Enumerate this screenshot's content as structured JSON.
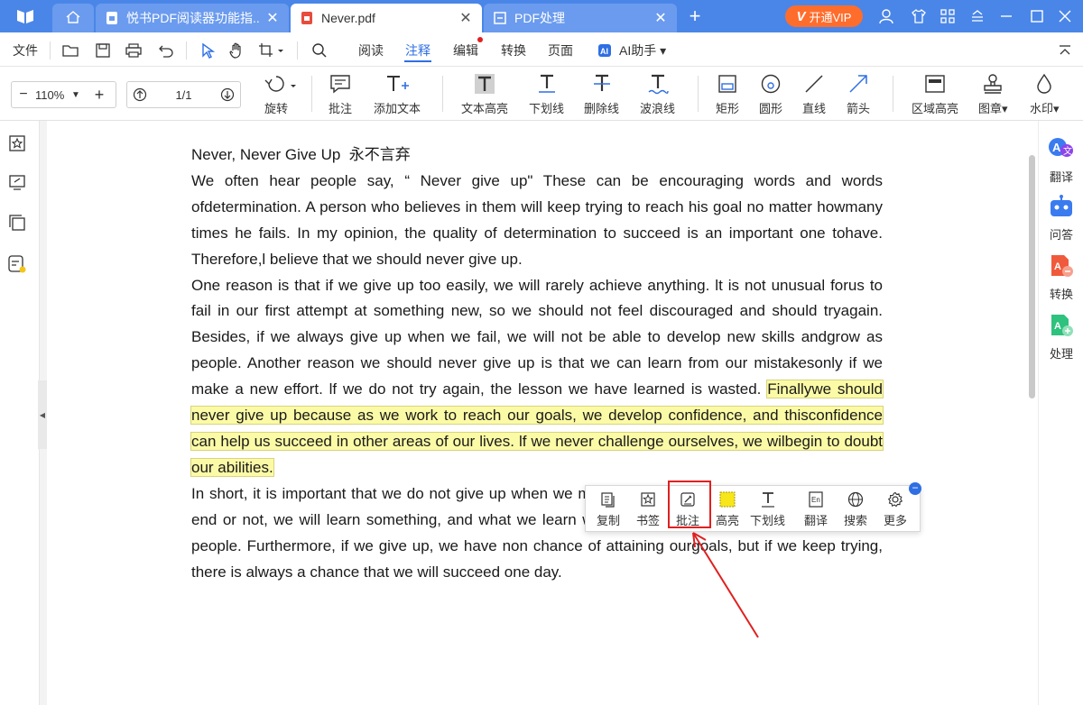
{
  "titlebar": {
    "tabs": [
      {
        "label": "悦书PDF阅读器功能指..."
      },
      {
        "label": "Never.pdf"
      },
      {
        "label": "PDF处理"
      }
    ],
    "vip_v": "V",
    "vip_label": "开通VIP"
  },
  "menubar": {
    "file": "文件",
    "items": [
      "阅读",
      "注释",
      "编辑",
      "转换",
      "页面"
    ],
    "ai": "AI助手 ▾"
  },
  "toolbar": {
    "zoom": "110%",
    "page": "1/1",
    "tools": [
      "旋转",
      "批注",
      "添加文本",
      "文本高亮",
      "下划线",
      "删除线",
      "波浪线",
      "矩形",
      "圆形",
      "直线",
      "箭头",
      "区域高亮",
      "图章",
      "水印"
    ]
  },
  "document": {
    "title_en": "Never, Never Give Up",
    "title_cn": "永不言弃",
    "p1": "We often hear people say,  “ Never give up\" These can be encouraging words and words ofdetermination. A person who believes in them will keep trying to reach his goal no matter howmany times he fails. In my opinion, the quality of determination to succeed is an important one tohave. Therefore,l believe that we should never give up.",
    "p2_before": "One reason is that if we give up too easily, we will rarely achieve anything. lt is not unusual forus to fail in our first attempt at something new, so we should not feel discouraged and should tryagain. Besides, if we always give up when we fail, we will not be able to develop new skills andgrow as people. Another reason we should never give up is that we can learn from our mistakesonly if we make a new effort. lf we do not try again, the lesson we have learned is wasted. ",
    "p2_highlight": "Finallywe should never give up because as we work to reach our goals, we develop confidence, and thisconfidence can help us succeed in other areas of our lives. lf we never challenge ourselves, we wilbegin to doubt our abilities.",
    "p3": "In short, it is important that we do not give up when we meet difficulties. Whether we succeed in the end or not, we will learn something, and what we learn will help us become stronger and confident people. Furthermore, if we give up, we have non chance of attaining ourgoals, but if we keep trying, there is always a chance that we will succeed one day."
  },
  "rightpanel": [
    "翻译",
    "问答",
    "转换",
    "处理"
  ],
  "popup": [
    "复制",
    "书签",
    "批注",
    "高亮",
    "下划线",
    "翻译",
    "搜索",
    "更多"
  ],
  "minus_symbol": "−",
  "colors": {
    "accent": "#4a86e8",
    "highlight": "#fbfaa6",
    "vip": "#ff6d2d",
    "redbox": "#e02020"
  }
}
